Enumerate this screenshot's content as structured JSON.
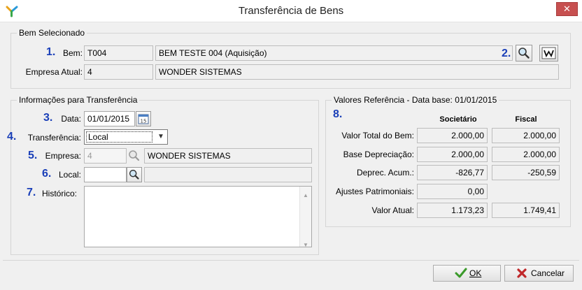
{
  "window": {
    "title": "Transferência de Bens",
    "close_glyph": "✕"
  },
  "bem_selecionado": {
    "legend": "Bem Selecionado",
    "bem_label": "Bem:",
    "bem_code": "T004",
    "bem_desc": "BEM TESTE 004 (Aquisição)",
    "empresa_label": "Empresa Atual:",
    "empresa_code": "4",
    "empresa_name": "WONDER SISTEMAS",
    "marker1": "1.",
    "marker2": "2."
  },
  "info": {
    "legend": "Informações para Transferência",
    "data_marker": "3.",
    "data_label": "Data:",
    "data_value": "01/01/2015",
    "transf_marker": "4.",
    "transf_label": "Transferência:",
    "transf_value": "Local",
    "empresa_marker": "5.",
    "empresa_label": "Empresa:",
    "empresa_code": "4",
    "empresa_name": "WONDER SISTEMAS",
    "local_marker": "6.",
    "local_label": "Local:",
    "local_code": "",
    "local_desc": "",
    "hist_marker": "7.",
    "hist_label": "Histórico:",
    "hist_value": ""
  },
  "valores": {
    "legend": "Valores Referência - Data base: 01/01/2015",
    "marker": "8.",
    "col_societario": "Societário",
    "col_fiscal": "Fiscal",
    "rows": [
      {
        "label": "Valor Total do Bem:",
        "societario": "2.000,00",
        "fiscal": "2.000,00"
      },
      {
        "label": "Base Depreciação:",
        "societario": "2.000,00",
        "fiscal": "2.000,00"
      },
      {
        "label": "Deprec. Acum.:",
        "societario": "-826,77",
        "fiscal": "-250,59"
      },
      {
        "label": "Ajustes Patrimoniais:",
        "societario": "0,00",
        "fiscal": ""
      },
      {
        "label": "Valor Atual:",
        "societario": "1.173,23",
        "fiscal": "1.749,41"
      }
    ]
  },
  "buttons": {
    "ok": "OK",
    "cancel": "Cancelar"
  },
  "icons": {
    "search": "search-icon",
    "wiki": "wiki-icon",
    "calendar": "calendar-icon"
  },
  "colors": {
    "marker": "#1a3fb8",
    "ok_check": "#3a9a2a",
    "cancel_x": "#c0282a"
  }
}
